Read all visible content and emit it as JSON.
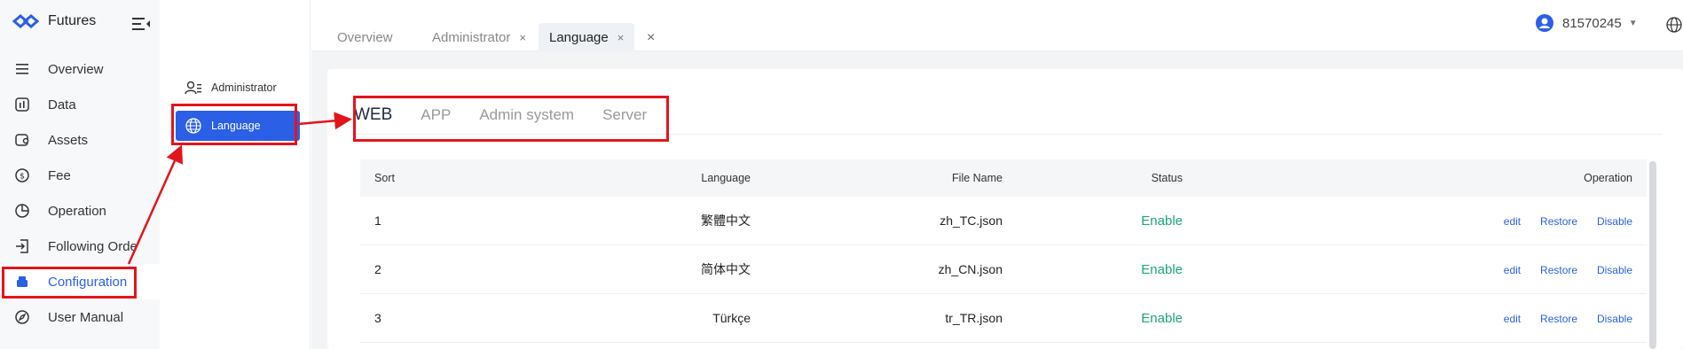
{
  "app": {
    "title": "Futures"
  },
  "sidebar": {
    "items": [
      {
        "label": "Overview",
        "icon": "list-icon"
      },
      {
        "label": "Data",
        "icon": "chart-icon"
      },
      {
        "label": "Assets",
        "icon": "wallet-icon"
      },
      {
        "label": "Fee",
        "icon": "coin-icon"
      },
      {
        "label": "Operation",
        "icon": "pie-icon"
      },
      {
        "label": "Following Orde",
        "icon": "login-icon"
      },
      {
        "label": "Configuration",
        "icon": "config-icon",
        "active": true
      },
      {
        "label": "User Manual",
        "icon": "compass-icon"
      }
    ]
  },
  "submenu": {
    "items": [
      {
        "label": "Administrator",
        "icon": "admin-icon"
      },
      {
        "label": "Language",
        "icon": "globe-icon",
        "active": true
      }
    ]
  },
  "tabs": [
    {
      "label": "Overview"
    },
    {
      "label": "Administrator",
      "closable": true
    },
    {
      "label": "Language",
      "closable": true,
      "active": true
    }
  ],
  "tab_close_glyph": "×",
  "user": {
    "name": "81570245"
  },
  "language_tabs": [
    "WEB",
    "APP",
    "Admin system",
    "Server"
  ],
  "table": {
    "headers": {
      "sort": "Sort",
      "language": "Language",
      "file": "File Name",
      "status": "Status",
      "operation": "Operation"
    },
    "rows": [
      {
        "sort": "1",
        "language": "繁體中文",
        "file": "zh_TC.json",
        "status": "Enable"
      },
      {
        "sort": "2",
        "language": "简体中文",
        "file": "zh_CN.json",
        "status": "Enable"
      },
      {
        "sort": "3",
        "language": "Türkçe",
        "file": "tr_TR.json",
        "status": "Enable"
      }
    ],
    "actions": {
      "edit": "edit",
      "restore": "Restore",
      "disable": "Disable"
    }
  },
  "colors": {
    "accent": "#2a5fe6",
    "enable": "#1aa67a",
    "annotation": "#e3141b"
  }
}
